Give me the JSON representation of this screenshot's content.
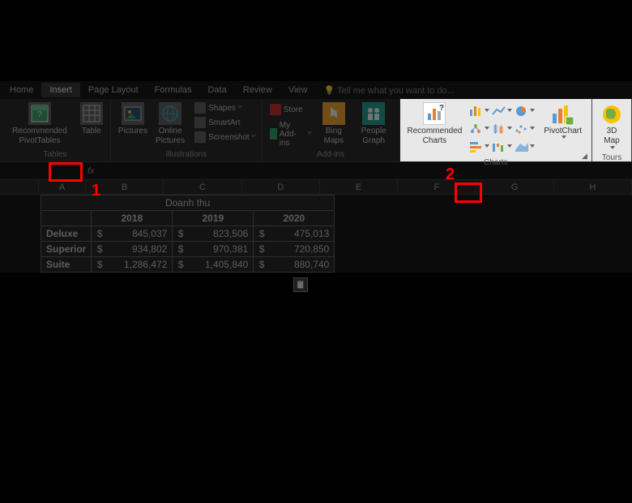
{
  "ribbon": {
    "tabs": [
      "Home",
      "Insert",
      "Page Layout",
      "Formulas",
      "Data",
      "Review",
      "View"
    ],
    "active_tab": "Insert",
    "tellme": "Tell me what you want to do...",
    "groups": {
      "tables": {
        "label": "Tables",
        "recommended_pivot": "Recommended\nPivotTables",
        "table": "Table"
      },
      "illustrations": {
        "label": "Illustrations",
        "pictures": "Pictures",
        "online_pictures": "Online\nPictures",
        "shapes": "Shapes",
        "smartart": "SmartArt",
        "screenshot": "Screenshot"
      },
      "addins": {
        "label": "Add-ins",
        "store": "Store",
        "my_addins": "My Add-ins",
        "bing_maps": "Bing\nMaps",
        "people_graph": "People\nGraph"
      },
      "charts": {
        "label": "Charts",
        "recommended": "Recommended\nCharts",
        "pivot_chart": "PivotChart"
      },
      "tours": {
        "label": "Tours",
        "map3d": "3D\nMap"
      }
    }
  },
  "formula_bar": {
    "fx": "fx"
  },
  "columns": [
    "A",
    "B",
    "C",
    "D",
    "E",
    "F",
    "G",
    "H"
  ],
  "sheet": {
    "title": "Doanh thu",
    "years": [
      "2018",
      "2019",
      "2020"
    ],
    "currency": "$",
    "rows": [
      {
        "label": "Deluxe",
        "values": [
          "845,037",
          "823,506",
          "475,013"
        ]
      },
      {
        "label": "Superior",
        "values": [
          "934,802",
          "970,381",
          "720,850"
        ]
      },
      {
        "label": "Suite",
        "values": [
          "1,286,472",
          "1,405,840",
          "880,740"
        ]
      }
    ]
  },
  "annotations": {
    "one": "1",
    "two": "2"
  }
}
